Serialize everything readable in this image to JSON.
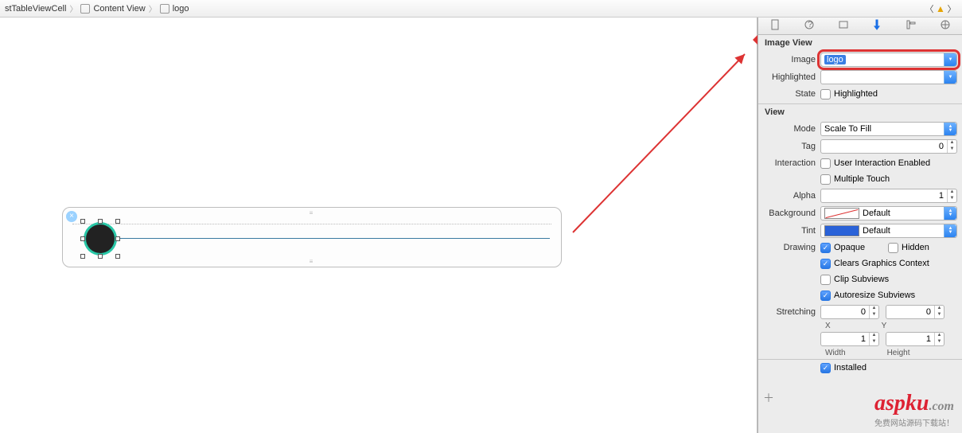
{
  "breadcrumbs": {
    "a": "stTableViewCell",
    "b": "Content View",
    "c": "logo"
  },
  "imageView": {
    "title": "Image View",
    "imageLabel": "Image",
    "imageValue": "logo",
    "highlightedLabel": "Highlighted",
    "highlightedValue": "",
    "stateLabel": "State",
    "stateChkLabel": "Highlighted"
  },
  "view": {
    "title": "View",
    "modeLabel": "Mode",
    "modeValue": "Scale To Fill",
    "tagLabel": "Tag",
    "tagValue": "0",
    "interactionLabel": "Interaction",
    "uiEnabled": "User Interaction Enabled",
    "multiTouch": "Multiple Touch",
    "alphaLabel": "Alpha",
    "alphaValue": "1",
    "bgLabel": "Background",
    "bgValue": "Default",
    "tintLabel": "Tint",
    "tintValue": "Default",
    "drawingLabel": "Drawing",
    "opaque": "Opaque",
    "hidden": "Hidden",
    "clears": "Clears Graphics Context",
    "clip": "Clip Subviews",
    "autoresize": "Autoresize Subviews",
    "stretchLabel": "Stretching",
    "x": "0",
    "y": "0",
    "xCap": "X",
    "yCap": "Y",
    "w": "1",
    "h": "1",
    "wCap": "Width",
    "hCap": "Height",
    "installed": "Installed"
  },
  "watermark": {
    "brand": "aspku",
    "dot": ".com",
    "sub": "免费网站源码下载站！"
  }
}
